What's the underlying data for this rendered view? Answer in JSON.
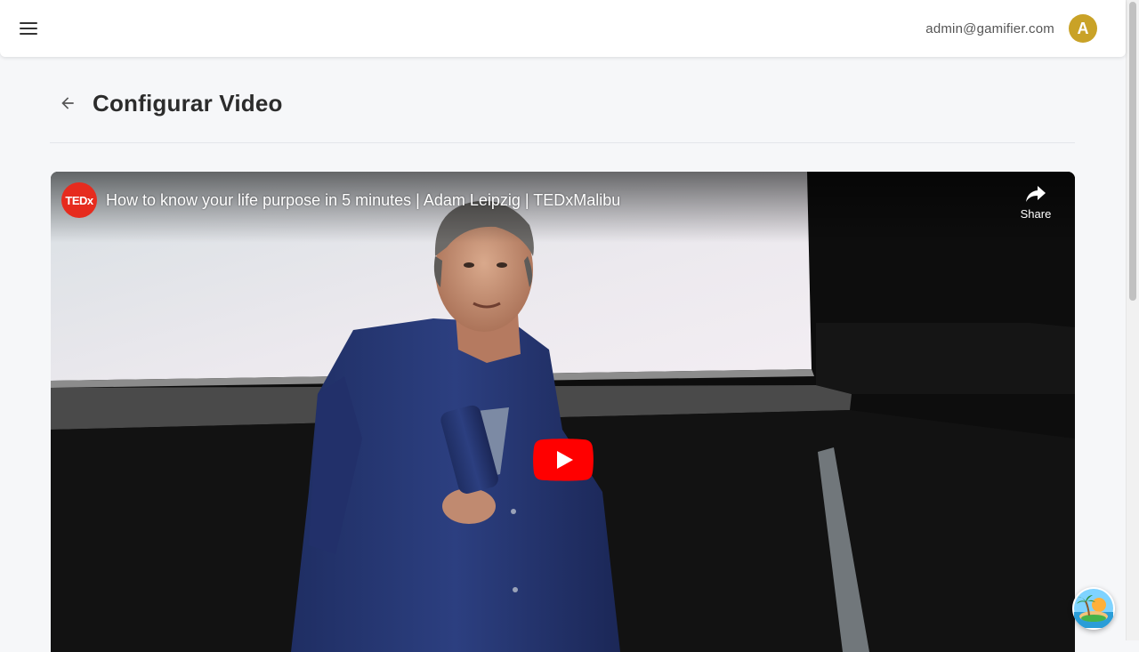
{
  "header": {
    "menu_icon": "hamburger-menu-icon",
    "user_email": "admin@gamifier.com",
    "avatar_initial": "A",
    "avatar_color": "#c9a227"
  },
  "page": {
    "back_icon": "arrow-left-icon",
    "title": "Configurar Video"
  },
  "video": {
    "channel_logo": "TEDx",
    "title": "How to know your life purpose in 5 minutes | Adam Leipzig | TEDxMalibu",
    "share_label": "Share",
    "share_icon": "share-arrow-icon",
    "play_icon": "youtube-play-icon",
    "play_color": "#ff0000"
  },
  "fab": {
    "icon": "island-palm-icon"
  }
}
